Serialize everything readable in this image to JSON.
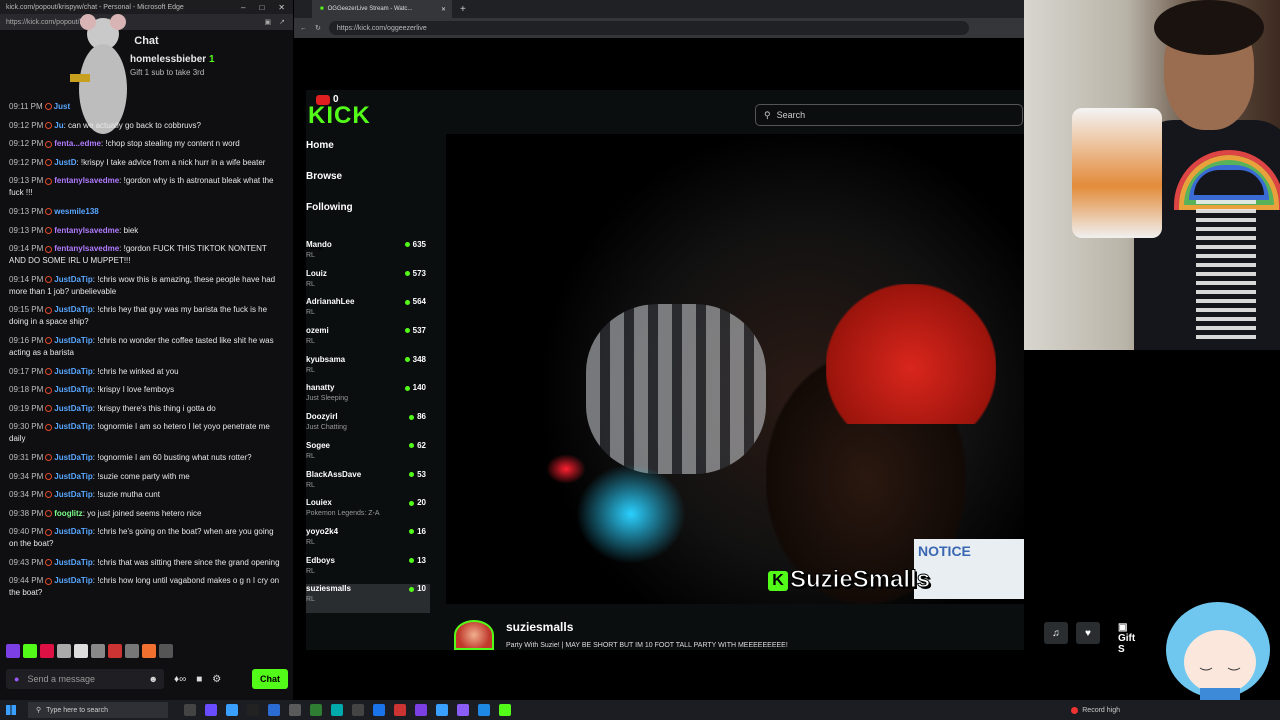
{
  "edge": {
    "window_title": "kick.com/popout/krispyw/chat - Personal - Microsoft Edge",
    "url": "https://kick.com/popout/krispyw/chat"
  },
  "chat": {
    "header": "Chat",
    "pinned": {
      "username": "homelessbieber",
      "count": "1",
      "subtext": "Gift 1 sub to take 3rd"
    },
    "messages": [
      {
        "time": "09:11 PM",
        "user": "Just",
        "color": "blue",
        "text": ""
      },
      {
        "time": "09:12 PM",
        "user": "Ju",
        "color": "blue",
        "text": "can we actually go back to cobbruvs?"
      },
      {
        "time": "09:12 PM",
        "user": "fenta...edme",
        "color": "purple",
        "text": "!chop stop stealing my content n word"
      },
      {
        "time": "09:12 PM",
        "user": "JustD",
        "color": "blue",
        "text": "!krispy I take advice from a nick hurr in a wife beater"
      },
      {
        "time": "09:13 PM",
        "user": "fentanylsavedme",
        "color": "purple",
        "text": "!gordon why is th astronaut bleak what the fuck !!!"
      },
      {
        "time": "09:13 PM",
        "user": "wesmile138",
        "color": "blue",
        "text": ""
      },
      {
        "time": "09:13 PM",
        "user": "fentanylsavedme",
        "color": "purple",
        "text": "biek"
      },
      {
        "time": "09:14 PM",
        "user": "fentanylsavedme",
        "color": "purple",
        "text": "!gordon FUCK THIS TIKTOK NONTENT AND DO SOME IRL U MUPPET!!!"
      },
      {
        "time": "09:14 PM",
        "user": "JustDaTip",
        "color": "blue",
        "text": "!chris wow this is amazing, these people have had more than 1 job? unbelievable"
      },
      {
        "time": "09:15 PM",
        "user": "JustDaTip",
        "color": "blue",
        "text": "!chris hey that guy was my barista the fuck is he doing in a space ship?"
      },
      {
        "time": "09:16 PM",
        "user": "JustDaTip",
        "color": "blue",
        "text": "!chris no wonder the coffee tasted like shit he was acting as a barista"
      },
      {
        "time": "09:17 PM",
        "user": "JustDaTip",
        "color": "blue",
        "text": "!chris he winked at you"
      },
      {
        "time": "09:18 PM",
        "user": "JustDaTip",
        "color": "blue",
        "text": "!krispy I love femboys"
      },
      {
        "time": "09:19 PM",
        "user": "JustDaTip",
        "color": "blue",
        "text": "!krispy there's this thing i gotta do"
      },
      {
        "time": "09:30 PM",
        "user": "JustDaTip",
        "color": "blue",
        "text": "!ognormie I am so hetero I let yoyo penetrate me daily"
      },
      {
        "time": "09:31 PM",
        "user": "JustDaTip",
        "color": "blue",
        "text": "!ognormie I am 60 busting what nuts rotter?"
      },
      {
        "time": "09:34 PM",
        "user": "JustDaTip",
        "color": "blue",
        "text": "!suzie come party with me"
      },
      {
        "time": "09:34 PM",
        "user": "JustDaTip",
        "color": "blue",
        "text": "!suzie mutha cunt"
      },
      {
        "time": "09:38 PM",
        "user": "fooglitz",
        "color": "green",
        "text": "yo just joined seems hetero nice"
      },
      {
        "time": "09:40 PM",
        "user": "JustDaTip",
        "color": "blue",
        "text": "!chris he's going on the boat? when are you going on the boat?"
      },
      {
        "time": "09:43 PM",
        "user": "JustDaTip",
        "color": "blue",
        "text": "!chris that was sitting there since the grand opening"
      },
      {
        "time": "09:44 PM",
        "user": "JustDaTip",
        "color": "blue",
        "text": "!chris how long until vagabond makes o g n I cry on the boat?"
      }
    ],
    "input_placeholder": "Send a message",
    "send_label": "Chat"
  },
  "browser": {
    "tab_title": "OGGeezerLive Stream - Watc...",
    "url": "https://kick.com/oggeezerlive"
  },
  "kick": {
    "logo": "KICK",
    "yt_count": "0",
    "search_placeholder": "Search",
    "nav": [
      "Home",
      "Browse",
      "Following"
    ],
    "following_header": "ving",
    "following": [
      {
        "name": "Mando",
        "game": "RL",
        "viewers": "635"
      },
      {
        "name": "Louiz",
        "game": "RL",
        "viewers": "573"
      },
      {
        "name": "AdrianahLee",
        "game": "RL",
        "viewers": "564"
      },
      {
        "name": "ozemi",
        "game": "RL",
        "viewers": "537"
      },
      {
        "name": "kyubsama",
        "game": "RL",
        "viewers": "348"
      },
      {
        "name": "hanatty",
        "game": "Just Sleeping",
        "viewers": "140"
      },
      {
        "name": "Doozyirl",
        "game": "Just Chatting",
        "viewers": "86"
      },
      {
        "name": "Sogee",
        "game": "RL",
        "viewers": "62"
      },
      {
        "name": "BlackAssDave",
        "game": "RL",
        "viewers": "53"
      },
      {
        "name": "Louiex",
        "game": "Pokemon Legends: Z-A",
        "viewers": "20"
      },
      {
        "name": "yoyo2k4",
        "game": "RL",
        "viewers": "16"
      },
      {
        "name": "Edboys",
        "game": "RL",
        "viewers": "13"
      },
      {
        "name": "suziesmalls",
        "game": "RL",
        "viewers": "10"
      }
    ],
    "video_overlay_name": "SuzieSmalls",
    "video_notice": "NOTICE",
    "streamer": "suziesmalls",
    "stream_title": "Party With Suzie! | MAY BE SHORT BUT IM 10 FOOT TALL PARTY WITH MEEEEEEEEE!",
    "gift_label": "Gift S"
  },
  "taskbar": {
    "search_placeholder": "Type here to search",
    "record_label": "Record high"
  }
}
